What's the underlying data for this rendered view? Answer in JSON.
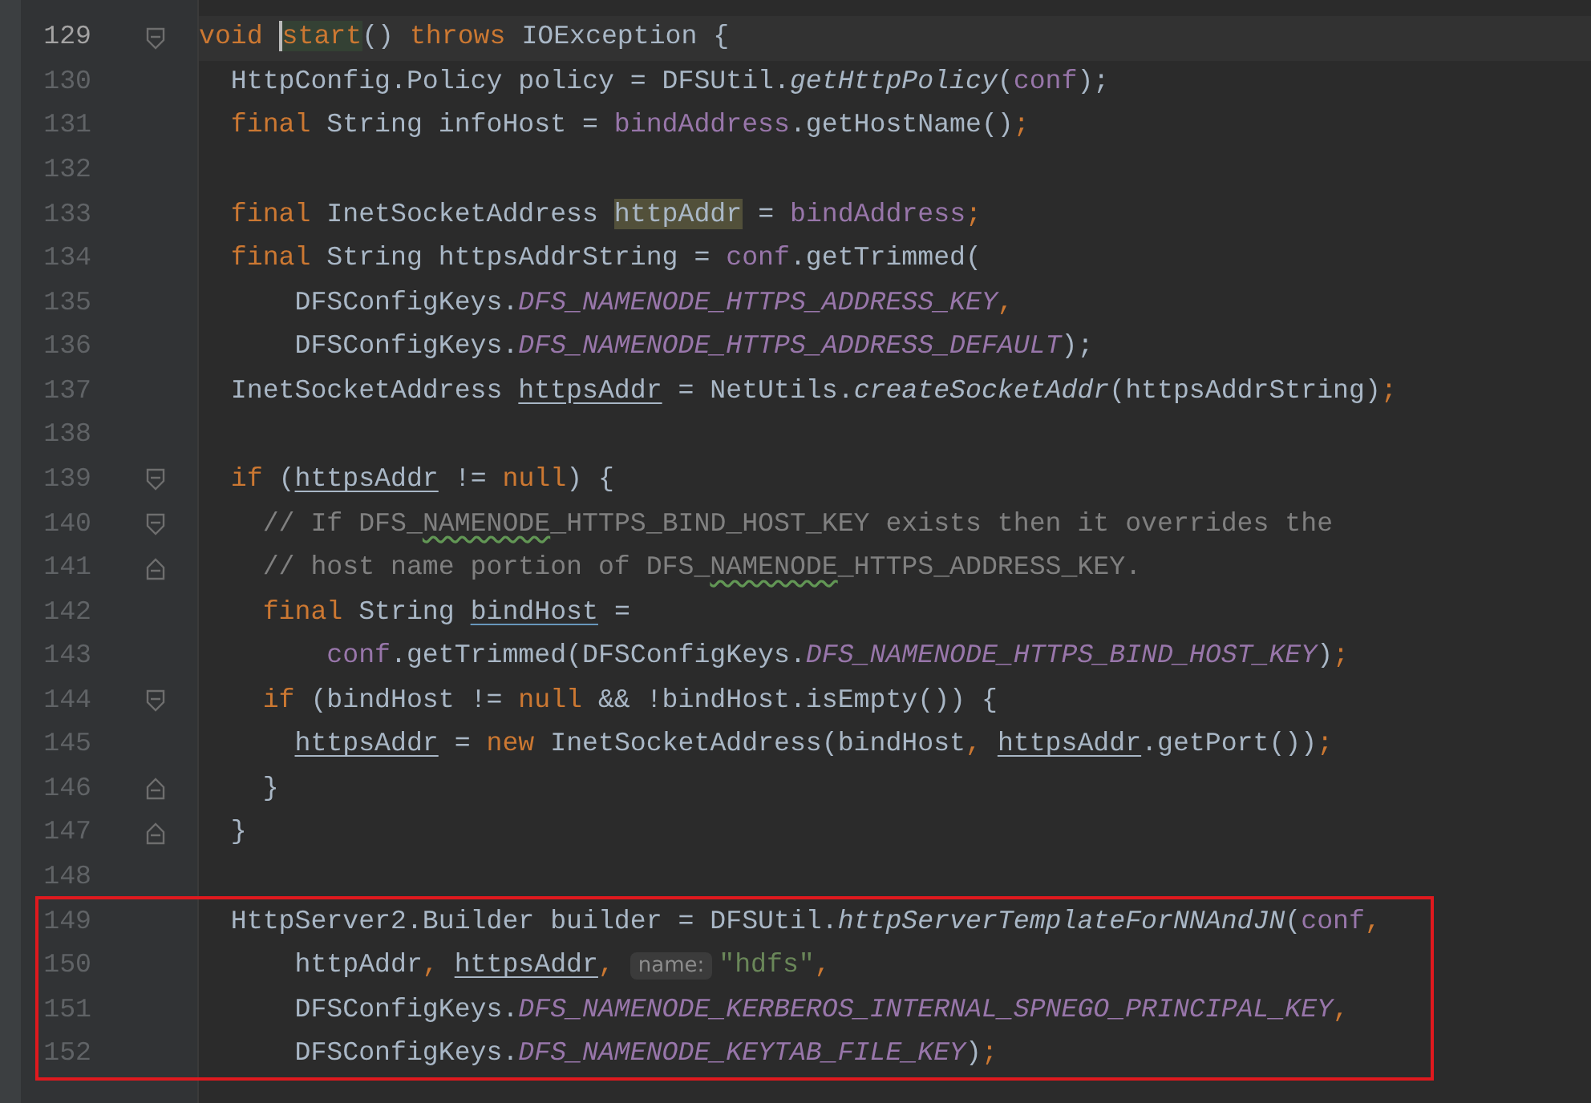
{
  "lines": [
    {
      "number": "129",
      "current": true,
      "kind": "fold-start",
      "boxed": false,
      "tokens": [
        {
          "text": "void ",
          "kind": "kw"
        },
        {
          "text": "start",
          "kind": "caret-symbol"
        },
        {
          "text": "() ",
          "kind": "plain"
        },
        {
          "text": "throws ",
          "kind": "kw"
        },
        {
          "text": "IOException {",
          "kind": "plain"
        }
      ]
    },
    {
      "number": "130",
      "current": false,
      "kind": "plain",
      "boxed": false,
      "tokens": [
        {
          "text": "  HttpConfig.Policy policy = DFSUtil.",
          "kind": "plain"
        },
        {
          "text": "getHttpPolicy",
          "kind": "italic"
        },
        {
          "text": "(",
          "kind": "plain"
        },
        {
          "text": "conf",
          "kind": "field"
        },
        {
          "text": ");",
          "kind": "plain"
        }
      ]
    },
    {
      "number": "131",
      "current": false,
      "kind": "plain",
      "boxed": false,
      "tokens": [
        {
          "text": "  final ",
          "kind": "kw"
        },
        {
          "text": "String infoHost = ",
          "kind": "plain"
        },
        {
          "text": "bindAddress",
          "kind": "field"
        },
        {
          "text": ".getHostName()",
          "kind": "plain"
        },
        {
          "text": ";",
          "kind": "kw"
        }
      ]
    },
    {
      "number": "132",
      "current": false,
      "kind": "plain",
      "boxed": false
    },
    {
      "number": "133",
      "current": false,
      "kind": "plain",
      "boxed": false,
      "tokens": [
        {
          "text": "  final ",
          "kind": "kw"
        },
        {
          "text": "InetSocketAddress ",
          "kind": "plain"
        },
        {
          "text": "httpAddr",
          "kind": "highlight"
        },
        {
          "text": " = ",
          "kind": "plain"
        },
        {
          "text": "bindAddress",
          "kind": "field"
        },
        {
          "text": ";",
          "kind": "kw"
        }
      ]
    },
    {
      "number": "134",
      "current": false,
      "kind": "plain",
      "boxed": false,
      "tokens": [
        {
          "text": "  final ",
          "kind": "kw"
        },
        {
          "text": "String httpsAddrString = ",
          "kind": "plain"
        },
        {
          "text": "conf",
          "kind": "field"
        },
        {
          "text": ".getTrimmed(",
          "kind": "plain"
        }
      ]
    },
    {
      "number": "135",
      "current": false,
      "kind": "plain",
      "boxed": false,
      "tokens": [
        {
          "text": "      DFSConfigKeys.",
          "kind": "plain"
        },
        {
          "text": "DFS_NAMENODE_HTTPS_ADDRESS_KEY",
          "kind": "static"
        },
        {
          "text": ",",
          "kind": "kw"
        }
      ]
    },
    {
      "number": "136",
      "current": false,
      "kind": "plain",
      "boxed": false,
      "tokens": [
        {
          "text": "      DFSConfigKeys.",
          "kind": "plain"
        },
        {
          "text": "DFS_NAMENODE_HTTPS_ADDRESS_DEFAULT",
          "kind": "static"
        },
        {
          "text": ");",
          "kind": "plain"
        }
      ]
    },
    {
      "number": "137",
      "current": false,
      "kind": "plain",
      "boxed": false,
      "tokens": [
        {
          "text": "  InetSocketAddress ",
          "kind": "plain"
        },
        {
          "text": "httpsAddr",
          "kind": "underline"
        },
        {
          "text": " = NetUtils.",
          "kind": "plain"
        },
        {
          "text": "createSocketAddr",
          "kind": "italic"
        },
        {
          "text": "(httpsAddrString)",
          "kind": "plain"
        },
        {
          "text": ";",
          "kind": "kw"
        }
      ]
    },
    {
      "number": "138",
      "current": false,
      "kind": "plain",
      "boxed": false
    },
    {
      "number": "139",
      "current": false,
      "kind": "fold-start",
      "boxed": false,
      "tokens": [
        {
          "text": "  if ",
          "kind": "kw"
        },
        {
          "text": "(",
          "kind": "plain"
        },
        {
          "text": "httpsAddr",
          "kind": "underline"
        },
        {
          "text": " != ",
          "kind": "plain"
        },
        {
          "text": "null",
          "kind": "kw"
        },
        {
          "text": ") {",
          "kind": "plain"
        }
      ]
    },
    {
      "number": "140",
      "current": false,
      "kind": "fold-start",
      "boxed": false,
      "tokens": [
        {
          "text": "    // If DFS_",
          "kind": "comment"
        },
        {
          "text": "NAMENODE",
          "kind": "typo"
        },
        {
          "text": "_HTTPS_BIND_HOST_KEY exists then it overrides the",
          "kind": "comment"
        }
      ]
    },
    {
      "number": "141",
      "current": false,
      "kind": "fold-end",
      "boxed": false,
      "tokens": [
        {
          "text": "    // host name portion of DFS_",
          "kind": "comment"
        },
        {
          "text": "NAMENODE",
          "kind": "typo"
        },
        {
          "text": "_HTTPS_ADDRESS_KEY.",
          "kind": "comment"
        }
      ]
    },
    {
      "number": "142",
      "current": false,
      "kind": "plain",
      "boxed": false,
      "tokens": [
        {
          "text": "    final ",
          "kind": "kw"
        },
        {
          "text": "String ",
          "kind": "plain"
        },
        {
          "text": "bindHost",
          "kind": "underline-decl"
        },
        {
          "text": " =",
          "kind": "plain"
        }
      ]
    },
    {
      "number": "143",
      "current": false,
      "kind": "plain",
      "boxed": false,
      "tokens": [
        {
          "text": "        conf",
          "kind": "field"
        },
        {
          "text": ".getTrimmed(DFSConfigKeys.",
          "kind": "plain"
        },
        {
          "text": "DFS_NAMENODE_HTTPS_BIND_HOST_KEY",
          "kind": "static"
        },
        {
          "text": ")",
          "kind": "plain"
        },
        {
          "text": ";",
          "kind": "kw"
        }
      ]
    },
    {
      "number": "144",
      "current": false,
      "kind": "fold-start",
      "boxed": false,
      "tokens": [
        {
          "text": "    if ",
          "kind": "kw"
        },
        {
          "text": "(bindHost != ",
          "kind": "plain"
        },
        {
          "text": "null ",
          "kind": "kw"
        },
        {
          "text": "&& !bindHost.isEmpty()) {",
          "kind": "plain"
        }
      ]
    },
    {
      "number": "145",
      "current": false,
      "kind": "plain",
      "boxed": false,
      "tokens": [
        {
          "text": "      httpsAddr",
          "kind": "underline"
        },
        {
          "text": " = ",
          "kind": "plain"
        },
        {
          "text": "new ",
          "kind": "kw"
        },
        {
          "text": "InetSocketAddress(bindHost",
          "kind": "plain"
        },
        {
          "text": ", ",
          "kind": "kw"
        },
        {
          "text": "httpsAddr",
          "kind": "underline"
        },
        {
          "text": ".getPort())",
          "kind": "plain"
        },
        {
          "text": ";",
          "kind": "kw"
        }
      ]
    },
    {
      "number": "146",
      "current": false,
      "kind": "fold-end",
      "boxed": false,
      "tokens": [
        {
          "text": "    }",
          "kind": "plain"
        }
      ]
    },
    {
      "number": "147",
      "current": false,
      "kind": "fold-end",
      "boxed": false,
      "tokens": [
        {
          "text": "  }",
          "kind": "plain"
        }
      ]
    },
    {
      "number": "148",
      "current": false,
      "kind": "plain",
      "boxed": false
    },
    {
      "number": "149",
      "current": false,
      "kind": "plain",
      "boxed": true,
      "tokens": [
        {
          "text": "  HttpServer2.Builder builder = DFSUtil.",
          "kind": "plain"
        },
        {
          "text": "httpServerTemplateForNNAndJN",
          "kind": "italic"
        },
        {
          "text": "(",
          "kind": "plain"
        },
        {
          "text": "conf",
          "kind": "field"
        },
        {
          "text": ",",
          "kind": "kw"
        }
      ]
    },
    {
      "number": "150",
      "current": false,
      "kind": "plain",
      "boxed": true,
      "tokens": [
        {
          "text": "      httpAddr",
          "kind": "plain"
        },
        {
          "text": ", ",
          "kind": "kw"
        },
        {
          "text": "httpsAddr",
          "kind": "underline"
        },
        {
          "text": ", ",
          "kind": "kw"
        },
        {
          "text": "name:",
          "kind": "hint"
        },
        {
          "text": "\"hdfs\"",
          "kind": "string"
        },
        {
          "text": ",",
          "kind": "kw"
        }
      ]
    },
    {
      "number": "151",
      "current": false,
      "kind": "plain",
      "boxed": true,
      "tokens": [
        {
          "text": "      DFSConfigKeys.",
          "kind": "plain"
        },
        {
          "text": "DFS_NAMENODE_KERBEROS_INTERNAL_SPNEGO_PRINCIPAL_KEY",
          "kind": "static"
        },
        {
          "text": ",",
          "kind": "kw"
        }
      ]
    },
    {
      "number": "152",
      "current": false,
      "kind": "plain",
      "boxed": true,
      "tokens": [
        {
          "text": "      DFSConfigKeys.",
          "kind": "plain"
        },
        {
          "text": "DFS_NAMENODE_KEYTAB_FILE_KEY",
          "kind": "static"
        },
        {
          "text": ")",
          "kind": "plain"
        },
        {
          "text": ";",
          "kind": "kw"
        }
      ]
    }
  ]
}
